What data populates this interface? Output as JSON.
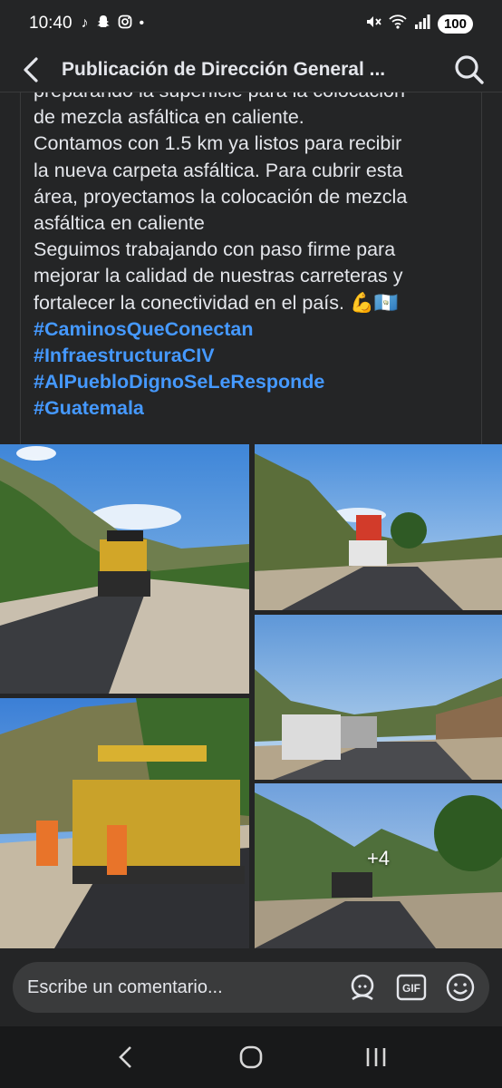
{
  "status_bar": {
    "time": "10:40",
    "battery": "100",
    "app_icons": [
      "tiktok-icon",
      "snapchat-icon",
      "instagram-icon",
      "dot-icon"
    ]
  },
  "header": {
    "title": "Publicación de Dirección General ..."
  },
  "post": {
    "lines": [
      "preparando la superficie para la colocación",
      "de mezcla asfáltica en caliente.",
      "Contamos con 1.5 km ya listos para recibir",
      "la nueva carpeta asfáltica. Para cubrir esta",
      "área, proyectamos la colocación de mezcla",
      "asfáltica en caliente",
      "Seguimos trabajando con paso firme para",
      "mejorar la calidad de nuestras carreteras y",
      "fortalecer la conectividad en el país. 💪🇬🇹"
    ],
    "hashtags": [
      "#CaminosQueConectan",
      "#InfraestructuraCIV",
      "#AlPuebloDignoSeLeResponde",
      "#Guatemala"
    ]
  },
  "gallery": {
    "more_count": "+4"
  },
  "comment": {
    "placeholder": "Escribe un comentario..."
  },
  "colors": {
    "background": "#242526",
    "hashtag": "#4599ff",
    "input": "#3a3b3c",
    "navbar": "#18191a"
  }
}
